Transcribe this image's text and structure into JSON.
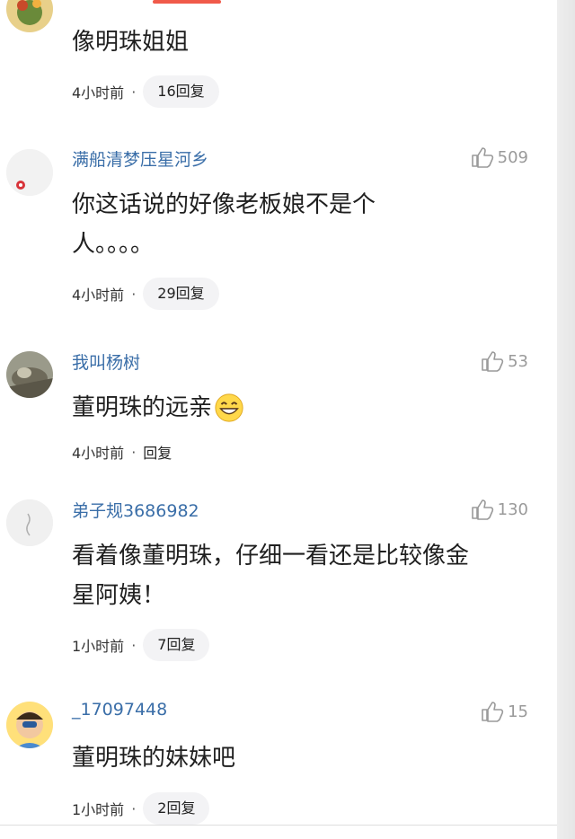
{
  "comments": [
    {
      "username": "",
      "likes": "",
      "lines": [
        "像明珠姐姐"
      ],
      "time": "4小时前",
      "reply": "16回复",
      "avatar_icon": "avatar-icon"
    },
    {
      "username": "满船清梦压星河乡",
      "likes": "509",
      "lines": [
        "你这话说的好像老板娘不是个",
        "人。。。。"
      ],
      "time": "4小时前",
      "reply": "29回复",
      "avatar_icon": "avatar-icon"
    },
    {
      "username": "我叫杨树",
      "likes": "53",
      "lines": [
        "董明珠的远亲"
      ],
      "time": "4小时前",
      "reply": "回复",
      "avatar_icon": "avatar-icon"
    },
    {
      "username": "弟子规3686982",
      "likes": "130",
      "lines": [
        "看着像董明珠，仔细一看还是比较像金",
        "星阿姨！"
      ],
      "time": "1小时前",
      "reply": "7回复",
      "avatar_icon": "avatar-icon"
    },
    {
      "username": "_17097448",
      "likes": "15",
      "lines": [
        "董明珠的妹妹吧"
      ],
      "time": "1小时前",
      "reply": "2回复",
      "avatar_icon": "avatar-icon"
    }
  ],
  "colors": {
    "username": "#3a6ea8",
    "accent": "#f05a4a",
    "pill": "#f3f3f5",
    "like": "#9a9a9a"
  },
  "icons": [
    "thumbs-up-icon",
    "grin-emoji-icon"
  ]
}
